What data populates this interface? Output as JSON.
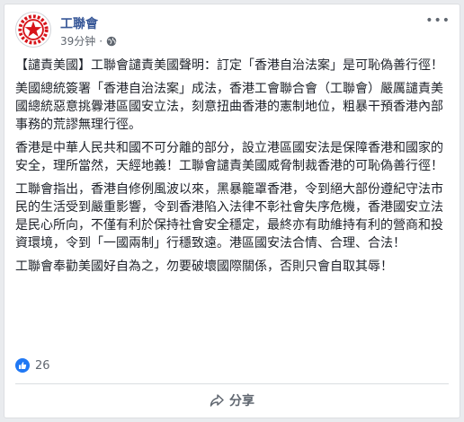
{
  "post": {
    "page_name": "工聯會",
    "timestamp": "39分钟",
    "separator": "·",
    "paragraphs": [
      "【譴責美國】工聯會譴責美國聲明：訂定「香港自治法案」是可恥偽善行徑！",
      "美國總統簽署「香港自治法案」成法，香港工會聯合會（工聯會）嚴厲譴責美國總統惡意挑釁港區國安立法，刻意扭曲香港的憲制地位，粗暴干預香港內部事務的荒謬無理行徑。",
      "香港是中華人民共和國不可分離的部分，設立港區國安法是保障香港和國家的安全，理所當然，天經地義！工聯會譴責美國威脅制裁香港的可恥偽善行徑！",
      "工聯會指出，香港自修例風波以來，黑暴籠罩香港，令到絕大部份遵紀守法市民的生活受到嚴重影響，令到香港陷入法律不彰社會失序危機，香港國安立法是民心所向，不僅有利於保持社會安全穩定，最終亦有助維持有利的營商和投資環境，令到「一國兩制」行穩致遠。港區國安法合情、合理、合法！",
      "工聯會奉勸美國好自為之，勿要破壞國際關係，否則只會自取其辱！"
    ]
  },
  "reactions": {
    "count": "26"
  },
  "actions": {
    "share_label": "分享"
  },
  "icons": {
    "avatar": "union-logo-icon",
    "privacy": "globe-icon",
    "reaction": "like-icon",
    "share": "share-arrow-icon",
    "more": "more-options-icon"
  },
  "colors": {
    "link": "#385898",
    "text": "#1d2129",
    "meta": "#606770",
    "like_blue": "#2078f4",
    "logo_red": "#d7141a"
  }
}
